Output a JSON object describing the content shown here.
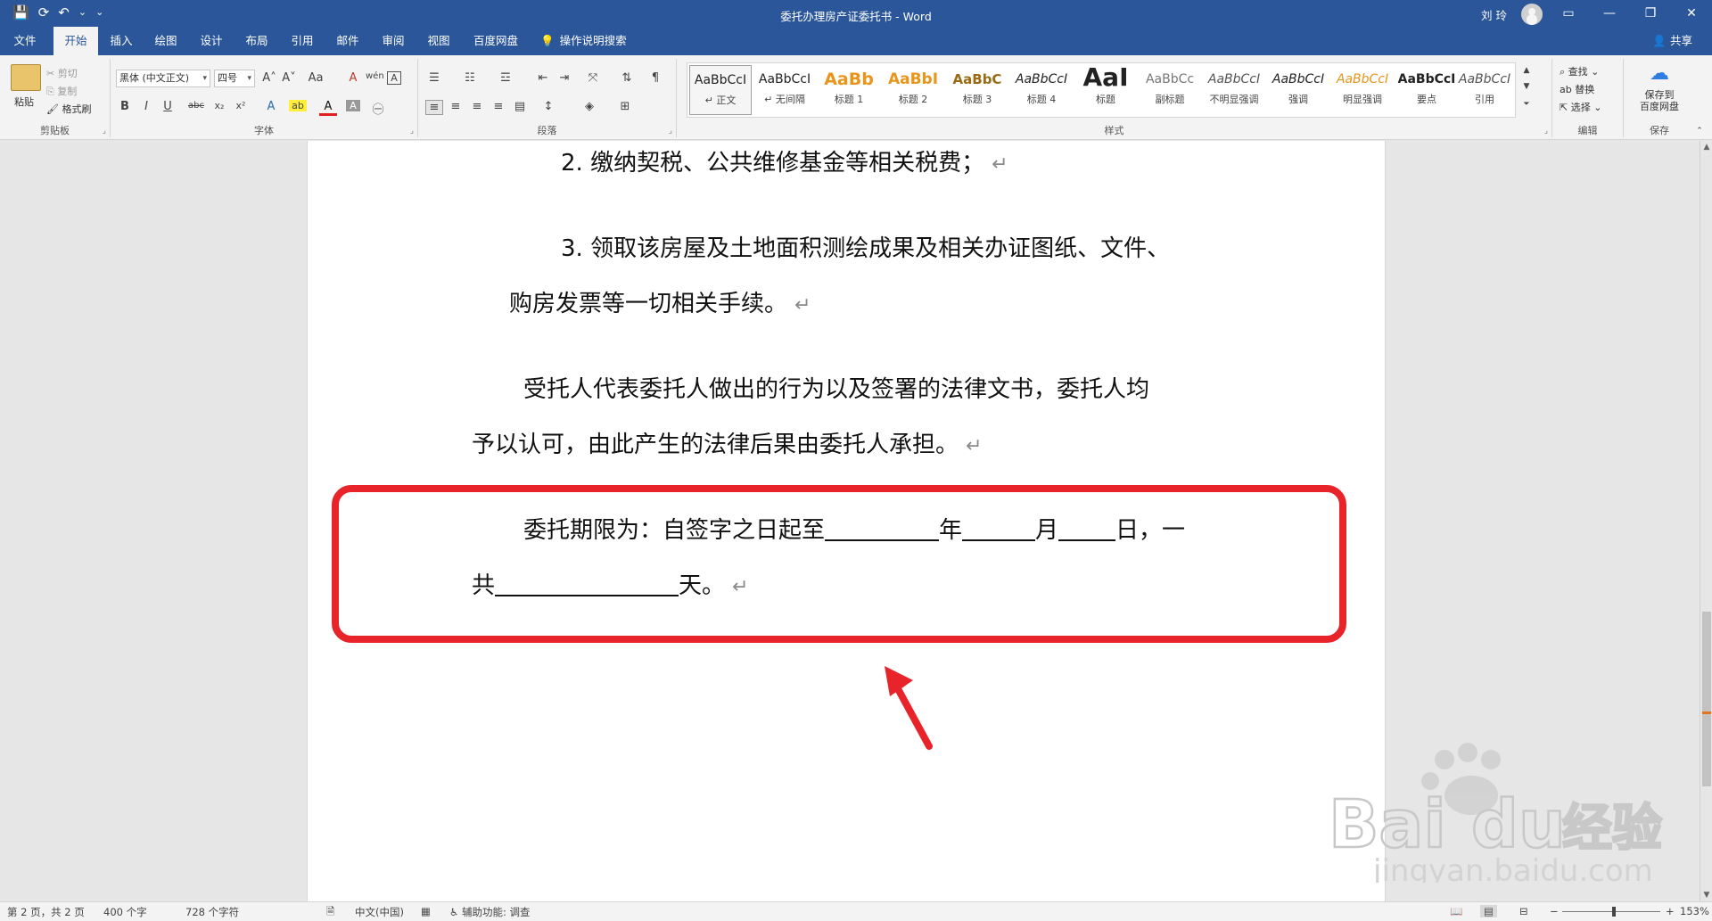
{
  "titlebar": {
    "title": "委托办理房产证委托书  -  Word",
    "user": "刘 玲",
    "qat": {
      "save": "💾",
      "autosave": "⟳",
      "undo": "↶",
      "undo_more": "⌄",
      "customize": "⌄"
    },
    "window": {
      "ribbon_display": "▭",
      "minimize": "—",
      "restore": "❐",
      "close": "✕"
    }
  },
  "tabs": [
    {
      "label": "文件"
    },
    {
      "label": "开始"
    },
    {
      "label": "插入"
    },
    {
      "label": "绘图"
    },
    {
      "label": "设计"
    },
    {
      "label": "布局"
    },
    {
      "label": "引用"
    },
    {
      "label": "邮件"
    },
    {
      "label": "审阅"
    },
    {
      "label": "视图"
    },
    {
      "label": "百度网盘"
    }
  ],
  "tell_me": "操作说明搜索",
  "share": "共享",
  "ribbon": {
    "clipboard": {
      "paste": "粘贴",
      "cut": "剪切",
      "copy": "复制",
      "format_painter": "格式刷",
      "label": "剪贴板"
    },
    "font": {
      "family": "黑体 (中文正文)",
      "size": "四号",
      "grow": "A˄",
      "shrink": "A˅",
      "case": "Aa",
      "clear": "A",
      "phonetic": "wén",
      "border": "A",
      "bold": "B",
      "italic": "I",
      "underline": "U",
      "strike": "abc",
      "sub": "x₂",
      "sup": "x²",
      "effects": "A",
      "highlight": "ab",
      "color": "A",
      "shading": "A",
      "enclose": "㊀",
      "label": "字体"
    },
    "paragraph": {
      "label": "段落"
    },
    "styles": {
      "label": "样式",
      "items": [
        {
          "preview": "AaBbCcI",
          "name": "↵ 正文"
        },
        {
          "preview": "AaBbCcI",
          "name": "↵ 无间隔"
        },
        {
          "preview": "AaBb",
          "name": "标题 1"
        },
        {
          "preview": "AaBbI",
          "name": "标题 2"
        },
        {
          "preview": "AaBbC",
          "name": "标题 3"
        },
        {
          "preview": "AaBbCcI",
          "name": "标题 4"
        },
        {
          "preview": "AaI",
          "name": "标题"
        },
        {
          "preview": "AaBbCc",
          "name": "副标题"
        },
        {
          "preview": "AaBbCcI",
          "name": "不明显强调"
        },
        {
          "preview": "AaBbCcI",
          "name": "强调"
        },
        {
          "preview": "AaBbCcI",
          "name": "明显强调"
        },
        {
          "preview": "AaBbCcI",
          "name": "要点"
        },
        {
          "preview": "AaBbCcI",
          "name": "引用"
        }
      ]
    },
    "editing": {
      "find": "查找",
      "replace": "替换",
      "select": "选择",
      "label": "编辑"
    },
    "save": {
      "button": "保存到\n百度网盘",
      "line1": "保存到",
      "line2": "百度网盘",
      "label": "保存"
    }
  },
  "document": {
    "line1": "2. 缴纳契税、公共维修基金等相关税费；",
    "line2": "3. 领取该房屋及土地面积测绘成果及相关办证图纸、文件、",
    "line3": "购房发票等一切相关手续。",
    "line4": "受托人代表委托人做出的行为以及签署的法律文书，委托人均",
    "line5": "予以认可，由此产生的法律后果由委托人承担。",
    "line6_a": "委托期限为：自签字之日起至",
    "line6_b": "年",
    "line6_c": "月",
    "line6_d": "日，一",
    "line7_a": "共",
    "line7_b": "天。",
    "para_mark": "↵"
  },
  "annotation_color": "#e8232a",
  "status": {
    "page": "第 2 页，共 2 页",
    "words": "400 个字",
    "chars": "728 个字符",
    "language": "中文(中国)",
    "accessibility": "辅助功能: 调查",
    "zoom": "153%",
    "zoom_minus": "−",
    "zoom_plus": "+"
  },
  "watermark": {
    "brand": "Bai",
    "brand2": "du",
    "cn": "经验",
    "url": "jingyan.baidu.com"
  }
}
